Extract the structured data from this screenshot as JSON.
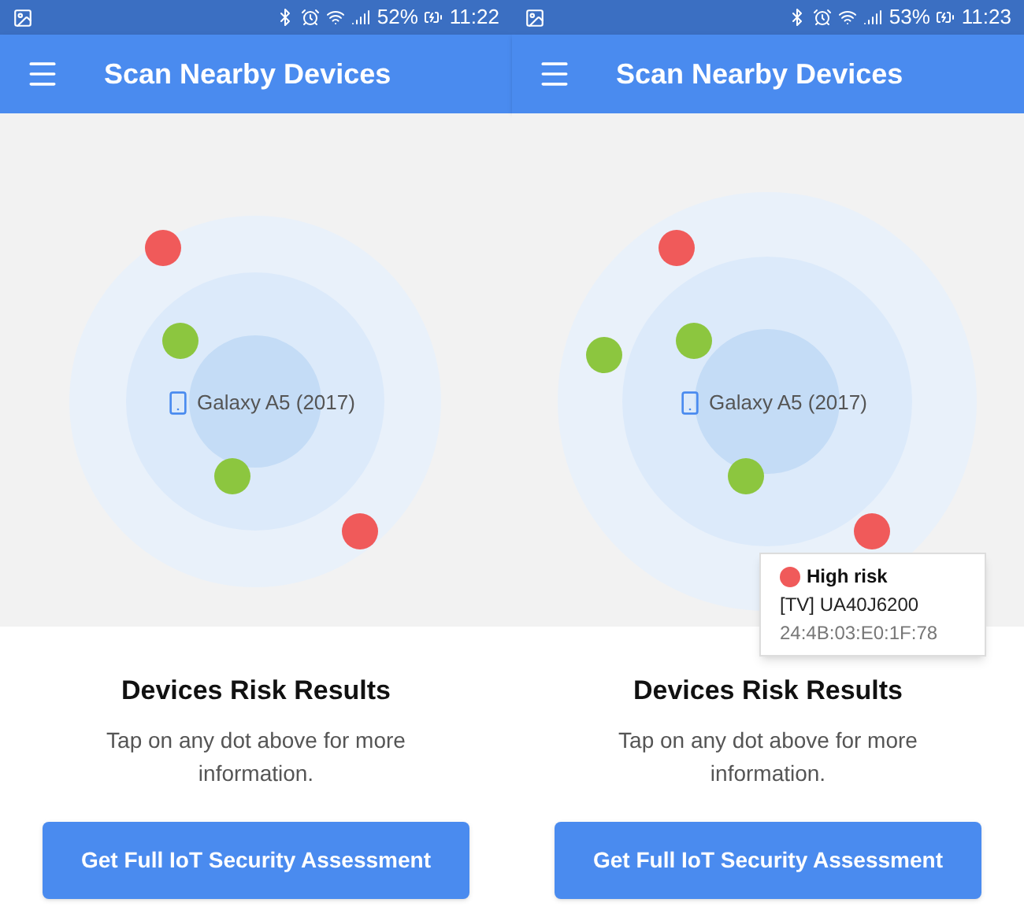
{
  "panels": [
    {
      "status_bar": {
        "battery": "52%",
        "time": "11:22"
      },
      "title": "Scan Nearby Devices",
      "radar": {
        "device_label": "Galaxy A5 (2017)",
        "dots": [
          {
            "color": "#f05a5a"
          },
          {
            "color": "#8cc63f"
          },
          {
            "color": "#8cc63f"
          },
          {
            "color": "#f05a5a"
          }
        ]
      },
      "results": {
        "title": "Devices Risk Results",
        "text": "Tap on any dot above for more information."
      },
      "button": "Get Full IoT Security Assessment"
    },
    {
      "status_bar": {
        "battery": "53%",
        "time": "11:23"
      },
      "title": "Scan Nearby Devices",
      "radar": {
        "device_label": "Galaxy A5 (2017)",
        "dots": [
          {
            "color": "#f05a5a"
          },
          {
            "color": "#8cc63f"
          },
          {
            "color": "#8cc63f"
          },
          {
            "color": "#8cc63f"
          },
          {
            "color": "#f05a5a"
          }
        ]
      },
      "results": {
        "title": "Devices Risk Results",
        "text": "Tap on any dot above for more information."
      },
      "button": "Get Full IoT Security Assessment",
      "tooltip": {
        "risk": "High risk",
        "color": "#f05a5a",
        "device": "[TV] UA40J6200",
        "mac": "24:4B:03:E0:1F:78"
      }
    }
  ]
}
